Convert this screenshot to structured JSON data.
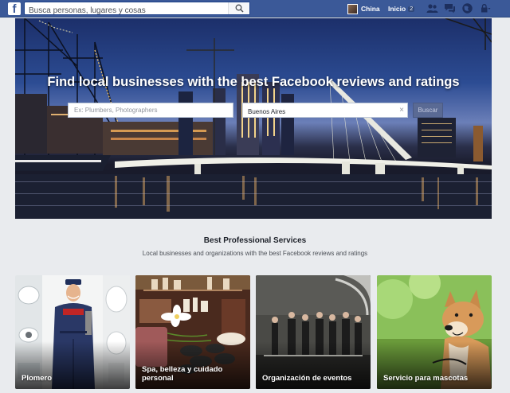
{
  "topbar": {
    "logo_letter": "f",
    "search_placeholder": "Busca personas, lugares y cosas",
    "profile_name": "China",
    "home_label": "Inicio",
    "home_count": "2",
    "icons": [
      "friend-requests-icon",
      "messages-icon",
      "notifications-icon",
      "privacy-icon"
    ],
    "brand_color": "#3b5998"
  },
  "hero": {
    "title": "Find local businesses with the best Facebook reviews and ratings",
    "search_placeholder": "Ex: Plumbers, Photographers",
    "location_value": "Buenos Aires",
    "clear_symbol": "×",
    "search_button_label": "Buscar"
  },
  "section": {
    "title": "Best Professional Services",
    "subtitle": "Local businesses and organizations with the best Facebook reviews and ratings"
  },
  "cards": [
    {
      "label": "Plomero"
    },
    {
      "label": "Spa, belleza y cuidado personal"
    },
    {
      "label": "Organización de eventos"
    },
    {
      "label": "Servicio para mascotas"
    }
  ]
}
